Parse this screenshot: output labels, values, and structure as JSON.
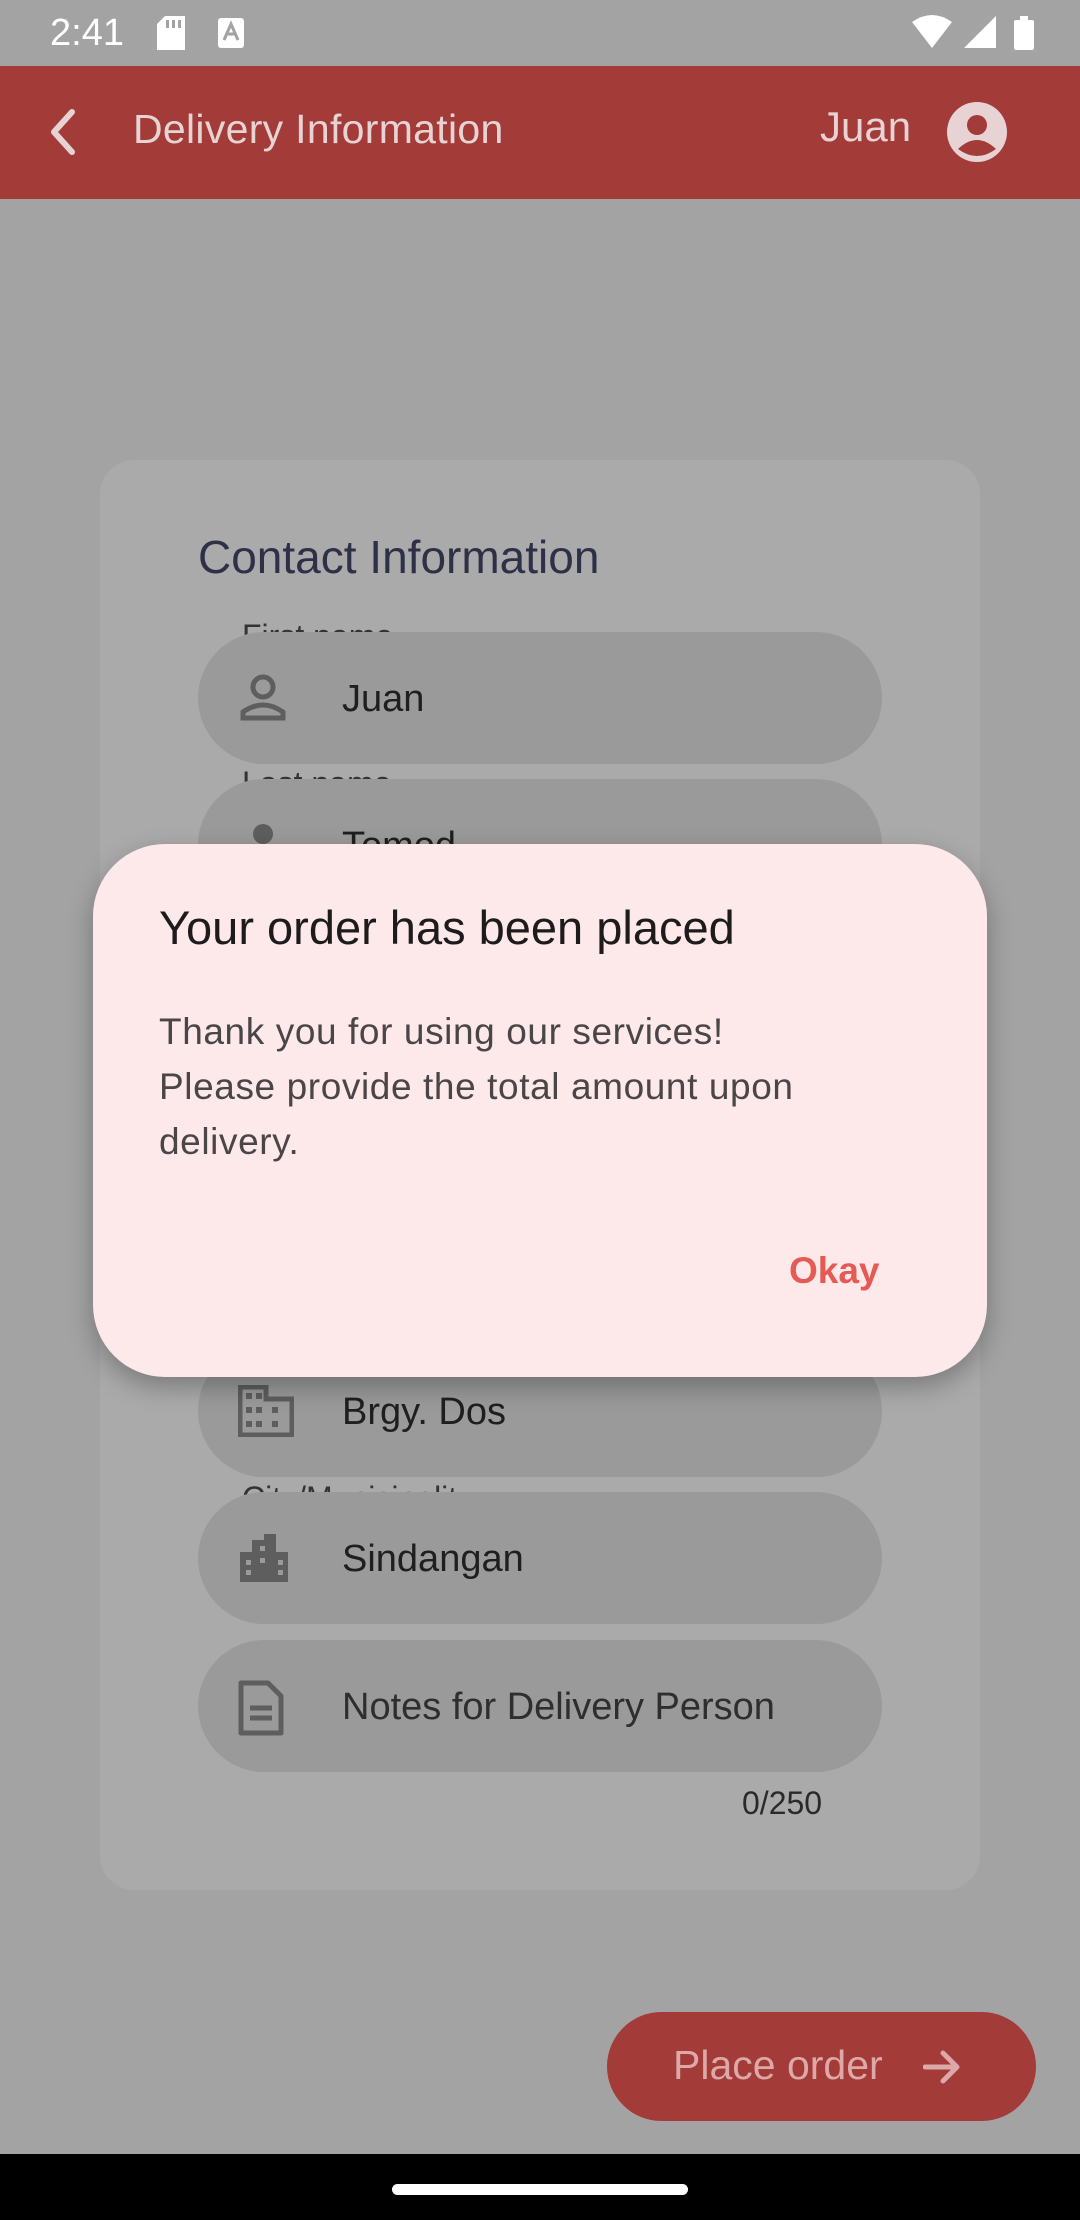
{
  "status_bar": {
    "time": "2:41"
  },
  "app_bar": {
    "title": "Delivery Information",
    "user_name": "Juan"
  },
  "card": {
    "title": "Contact Information",
    "fields": [
      {
        "label": "First name",
        "value": "Juan"
      },
      {
        "label": "Last name",
        "value": "Tomod"
      },
      {
        "value": "Brgy. Dos"
      },
      {
        "label": "City/Municipality",
        "value": "Sindangan"
      },
      {
        "placeholder": "Notes for Delivery Person"
      }
    ],
    "notes_counter": "0/250"
  },
  "place_order": {
    "label": "Place order"
  },
  "dialog": {
    "title": "Your order has been placed",
    "body_line1": "Thank you for using our services!",
    "body_line2": "Please provide the total amount upon delivery.",
    "action": "Okay"
  },
  "colors": {
    "app_bar": "#a33b39",
    "dialog_bg": "#fde8ea",
    "dialog_action": "#e55a54",
    "scrim_bg": "#a3a3a3"
  }
}
